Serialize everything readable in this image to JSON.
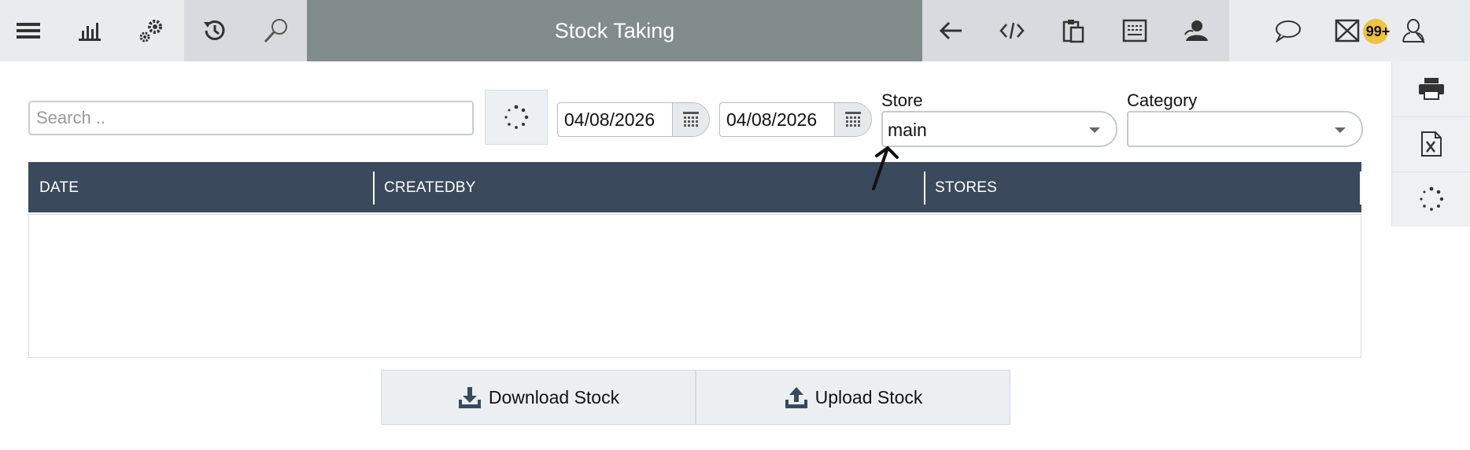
{
  "header": {
    "title": "Stock Taking",
    "notification_count": "99+"
  },
  "filters": {
    "search_placeholder": "Search ..",
    "date_from": "04/08/2026",
    "date_to": "04/08/2026",
    "store_label": "Store",
    "store_value": "main",
    "category_label": "Category",
    "category_value": ""
  },
  "table": {
    "columns": [
      "DATE",
      "CREATEDBY",
      "STORES"
    ],
    "rows": []
  },
  "actions": {
    "download_label": "Download Stock",
    "upload_label": "Upload Stock"
  },
  "colors": {
    "title_bg": "#838c8d",
    "table_header_bg": "#3a4a5c",
    "badge": "#efc23f"
  },
  "icons": {
    "left_toolbar": [
      "menu-icon",
      "bar-chart-icon",
      "gears-icon",
      "history-icon",
      "search-icon"
    ],
    "right_toolbar": [
      "back-arrow-icon",
      "code-icon",
      "clipboard-icon",
      "keyboard-icon",
      "user-icon",
      "chat-icon",
      "mail-icon",
      "profile-icon"
    ],
    "side_panel": [
      "print-icon",
      "excel-icon",
      "spinner-icon"
    ]
  }
}
